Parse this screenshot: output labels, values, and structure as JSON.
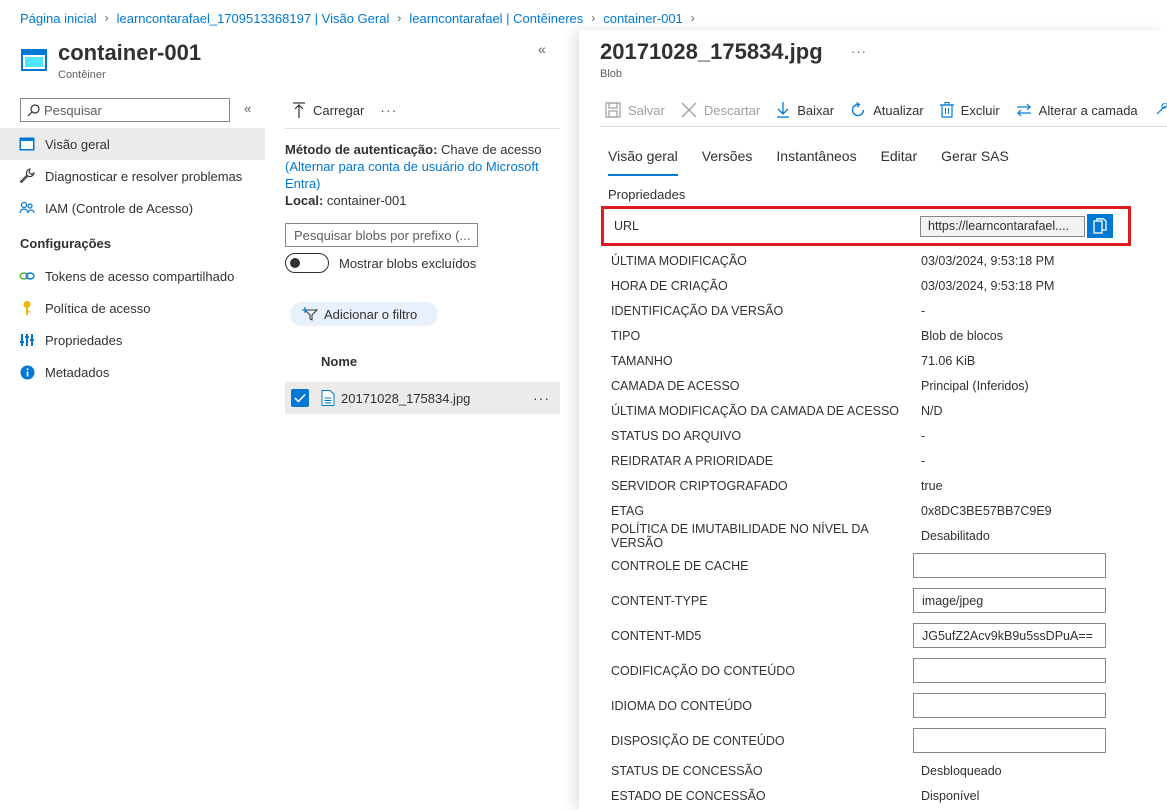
{
  "breadcrumb": {
    "items": [
      "Página inicial",
      "learncontarafael_1709513368197 | Visão Geral",
      "learncontarafael | Contêineres",
      "container-001"
    ]
  },
  "container": {
    "title": "container-001",
    "subtitle": "Contêiner"
  },
  "sidebar": {
    "search_placeholder": "Pesquisar",
    "items": [
      {
        "label": "Visão geral",
        "icon": "overview-icon"
      },
      {
        "label": "Diagnosticar e resolver problemas",
        "icon": "wrench-icon"
      },
      {
        "label": "IAM (Controle de Acesso)",
        "icon": "people-icon"
      }
    ],
    "section_label": "Configurações",
    "settings_items": [
      {
        "label": "Tokens de acesso compartilhado",
        "icon": "link-icon"
      },
      {
        "label": "Política de acesso",
        "icon": "key-icon"
      },
      {
        "label": "Propriedades",
        "icon": "properties-icon"
      },
      {
        "label": "Metadados",
        "icon": "info-icon"
      }
    ]
  },
  "middle": {
    "upload_label": "Carregar",
    "auth_label": "Método de autenticação:",
    "auth_value": "Chave de acesso",
    "auth_switch_link": "(Alternar para conta de usuário do Microsoft Entra)",
    "location_label": "Local:",
    "location_value": "container-001",
    "blob_search_placeholder": "Pesquisar blobs por prefixo (...",
    "show_deleted_label": "Mostrar blobs excluídos",
    "add_filter_label": "Adicionar o filtro",
    "column_name": "Nome",
    "files": [
      {
        "name": "20171028_175834.jpg",
        "selected": true
      }
    ]
  },
  "blob": {
    "title": "20171028_175834.jpg",
    "subtitle": "Blob",
    "toolbar": {
      "save": "Salvar",
      "discard": "Descartar",
      "download": "Baixar",
      "refresh": "Atualizar",
      "delete": "Excluir",
      "change_tier": "Alterar a camada"
    },
    "tabs": [
      "Visão geral",
      "Versões",
      "Instantâneos",
      "Editar",
      "Gerar SAS"
    ],
    "properties_label": "Propriedades",
    "url_label": "URL",
    "url_value": "https://learncontarafael....",
    "properties": [
      {
        "key": "ÚLTIMA MODIFICAÇÃO",
        "value": "03/03/2024, 9:53:18 PM"
      },
      {
        "key": "HORA DE CRIAÇÃO",
        "value": "03/03/2024, 9:53:18 PM"
      },
      {
        "key": "IDENTIFICAÇÃO DA VERSÃO",
        "value": "-"
      },
      {
        "key": "TIPO",
        "value": "Blob de blocos"
      },
      {
        "key": "TAMANHO",
        "value": "71.06 KiB"
      },
      {
        "key": "CAMADA DE ACESSO",
        "value": "Principal (Inferidos)"
      },
      {
        "key": "ÚLTIMA MODIFICAÇÃO DA CAMADA DE ACESSO",
        "value": "N/D"
      },
      {
        "key": "STATUS DO ARQUIVO",
        "value": "-"
      },
      {
        "key": "REIDRATAR A PRIORIDADE",
        "value": "-"
      },
      {
        "key": "SERVIDOR CRIPTOGRAFADO",
        "value": "true"
      },
      {
        "key": "ETAG",
        "value": "0x8DC3BE57BB7C9E9"
      },
      {
        "key": "POLÍTICA DE IMUTABILIDADE NO NÍVEL DA VERSÃO",
        "value": "Desabilitado"
      }
    ],
    "editable": [
      {
        "key": "CONTROLE DE CACHE",
        "value": ""
      },
      {
        "key": "CONTENT-TYPE",
        "value": "image/jpeg"
      },
      {
        "key": "CONTENT-MD5",
        "value": "JG5ufZ2Acv9kB9u5ssDPuA=="
      },
      {
        "key": "CODIFICAÇÃO DO CONTEÚDO",
        "value": ""
      },
      {
        "key": "IDIOMA DO CONTEÚDO",
        "value": ""
      },
      {
        "key": "DISPOSIÇÃO DE CONTEÚDO",
        "value": ""
      }
    ],
    "lease": [
      {
        "key": "STATUS DE CONCESSÃO",
        "value": "Desbloqueado"
      },
      {
        "key": "ESTADO DE CONCESSÃO",
        "value": "Disponível"
      }
    ]
  },
  "colors": {
    "accent": "#0078d4",
    "highlight_border": "#e01b1f",
    "selected_bg": "#edebe9"
  }
}
